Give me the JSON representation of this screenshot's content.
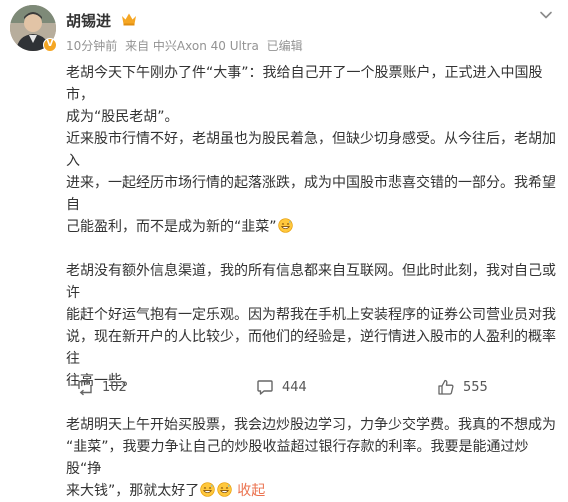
{
  "post": {
    "author": "胡锡进",
    "avatar_badge": "V",
    "meta": {
      "time": "10分钟前",
      "source": "来自 中兴Axon 40 Ultra",
      "edited": "已编辑"
    },
    "paragraphs": [
      {
        "lines": [
          "老胡今天下午刚办了件“大事”：我给自己开了一个股票账户，正式进入中国股市，",
          "成为“股民老胡”。",
          "近来股市行情不好，老胡虽也为股民着急，但缺少切身感受。从今往后，老胡加入",
          "进来，一起经历市场行情的起落涨跌，成为中国股市悲喜交错的一部分。我希望自",
          "己能盈利，而不是成为新的“韭菜”"
        ]
      },
      {
        "lines": [
          "老胡没有额外信息渠道，我的所有信息都来自互联网。但此时此刻，我对自己或许",
          "能赶个好运气抱有一定乐观。因为帮我在手机上安装程序的证券公司营业员对我",
          "说，现在新开户的人比较少，而他们的经验是，逆行情进入股市的人盈利的概率往",
          "往高一些。"
        ]
      },
      {
        "lines": [
          "老胡明天上午开始买股票，我会边炒股边学习，力争少交学费。我真的不想成为",
          "“韭菜”，我要力争让自己的炒股收益超过银行存款的利率。我要是能通过炒股“挣",
          "来大钱”，那就太好了"
        ],
        "collapse_label": "收起"
      }
    ],
    "emoji": "grin-sweat-emoji"
  },
  "actions": {
    "repost": "102",
    "comment": "444",
    "like": "555"
  },
  "colors": {
    "text": "#333333",
    "meta": "#939393",
    "accent": "#eb7350",
    "badge": "#f5a623"
  }
}
